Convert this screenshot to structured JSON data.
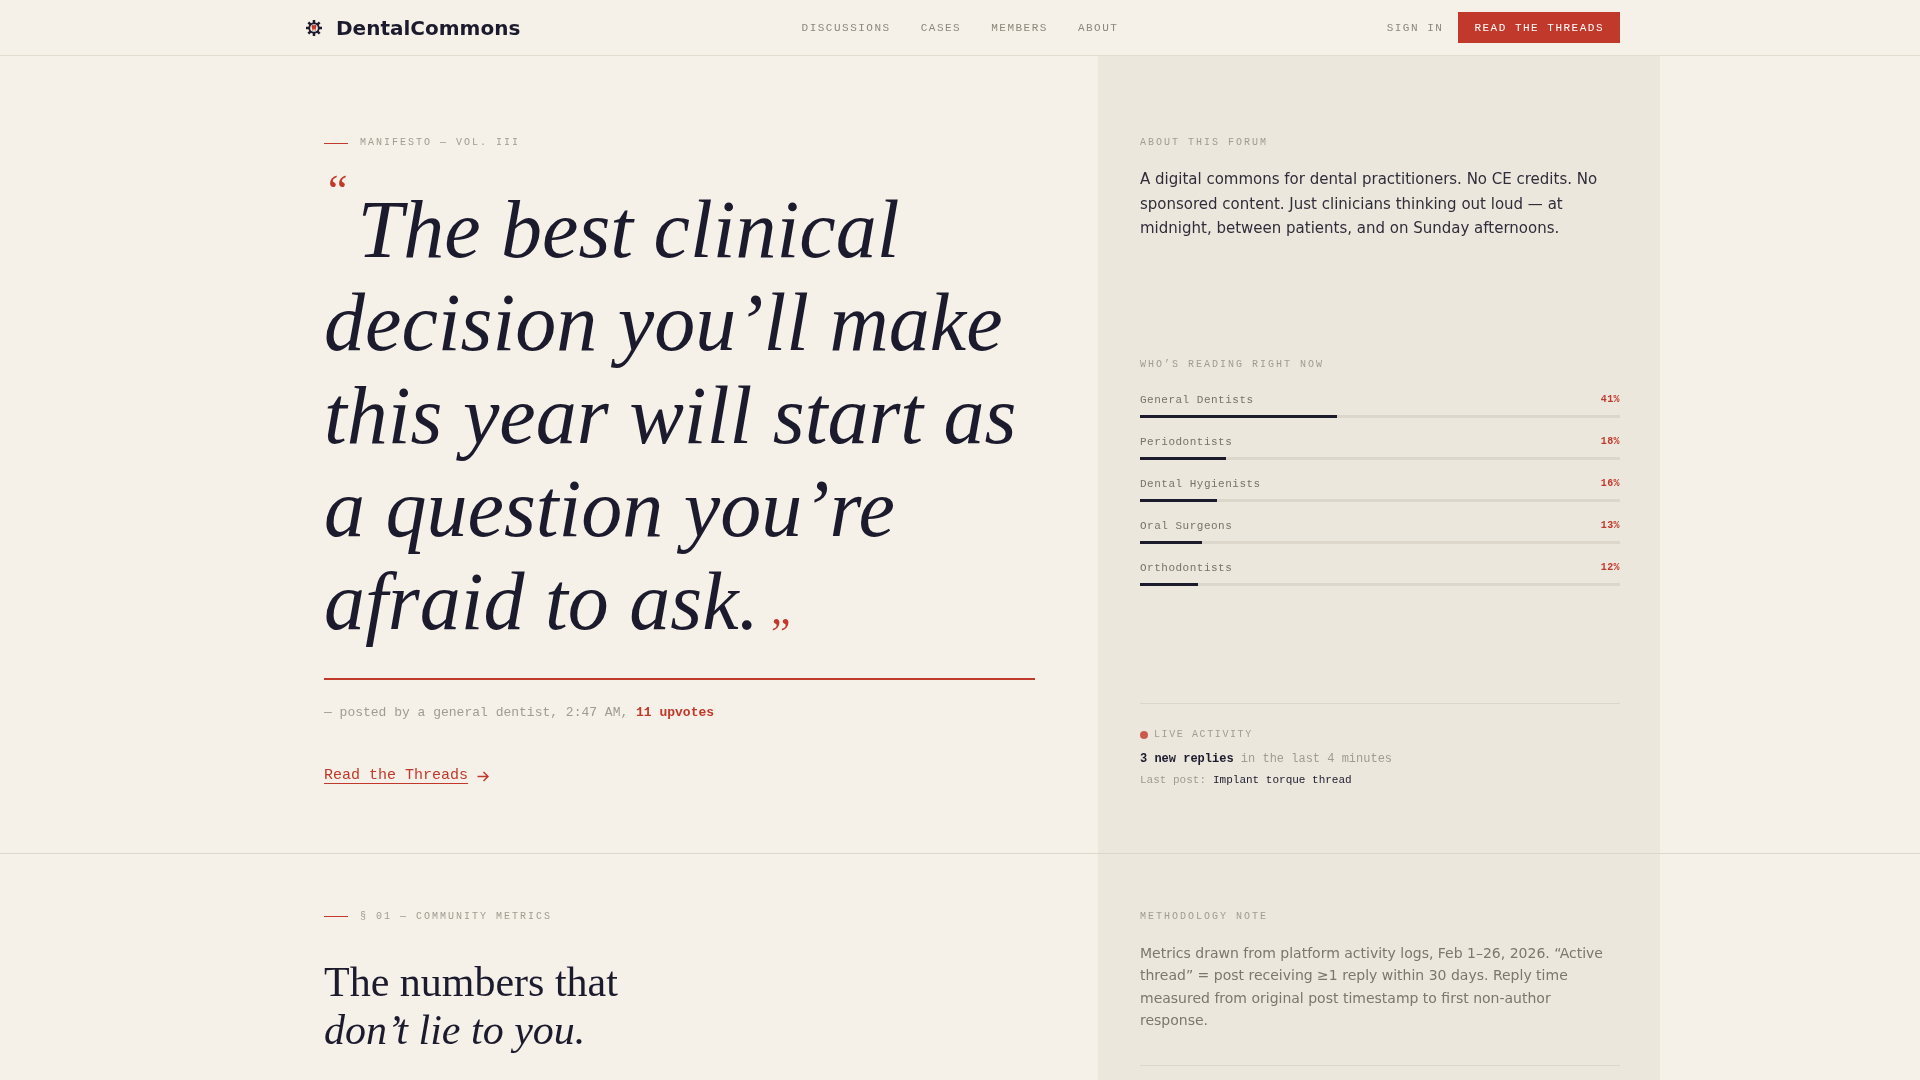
{
  "header": {
    "brand": "DentalCommons",
    "nav": [
      "DISCUSSIONS",
      "CASES",
      "MEMBERS",
      "ABOUT"
    ],
    "sign_in": "SIGN IN",
    "cta": "READ THE THREADS"
  },
  "hero": {
    "eyebrow": "MANIFESTO — VOL. III",
    "open_quote": "“",
    "quote": "The best clinical decision you’ll make this year will start as a question you’re afraid to ask.",
    "close_quote": "”",
    "byline": "— posted by a general dentist, 2:47 AM, **11 upvotes**",
    "link": "Read the Threads"
  },
  "about": {
    "title": "ABOUT THIS FORUM",
    "text": "A digital commons for dental practitioners. No CE credits. No sponsored content. Just clinicians thinking out loud — at midnight, between patients, and on Sunday afternoons."
  },
  "readers": {
    "title": "WHO’S READING RIGHT NOW",
    "rows": [
      {
        "label": "General Dentists",
        "reading": "41%",
        "level": 0.41
      },
      {
        "label": "Periodontists",
        "reading": "18%",
        "level": 0.18
      },
      {
        "label": "Dental Hygienists",
        "reading": "16%",
        "level": 0.16
      },
      {
        "label": "Oral Surgeons",
        "reading": "13%",
        "level": 0.13
      },
      {
        "label": "Orthodontists",
        "reading": "12%",
        "level": 0.12
      }
    ]
  },
  "live": {
    "title": "LIVE ACTIVITY",
    "summary": "**3 new replies** in the last 4 minutes",
    "last_post_label": "Last post:",
    "last_post_title": "Implant torque thread"
  },
  "metrics": {
    "eyebrow": "§ 01 — COMMUNITY METRICS",
    "heading": "The numbers that\n*don’t lie to you.*"
  },
  "methodology": {
    "title": "METHODOLOGY NOTE",
    "text": "Metrics drawn from platform activity logs, Feb 1–26, 2026. “Active thread” = post receiving ≥1 reply within 30 days. Reply time measured from original post timestamp to first non-author response."
  }
}
